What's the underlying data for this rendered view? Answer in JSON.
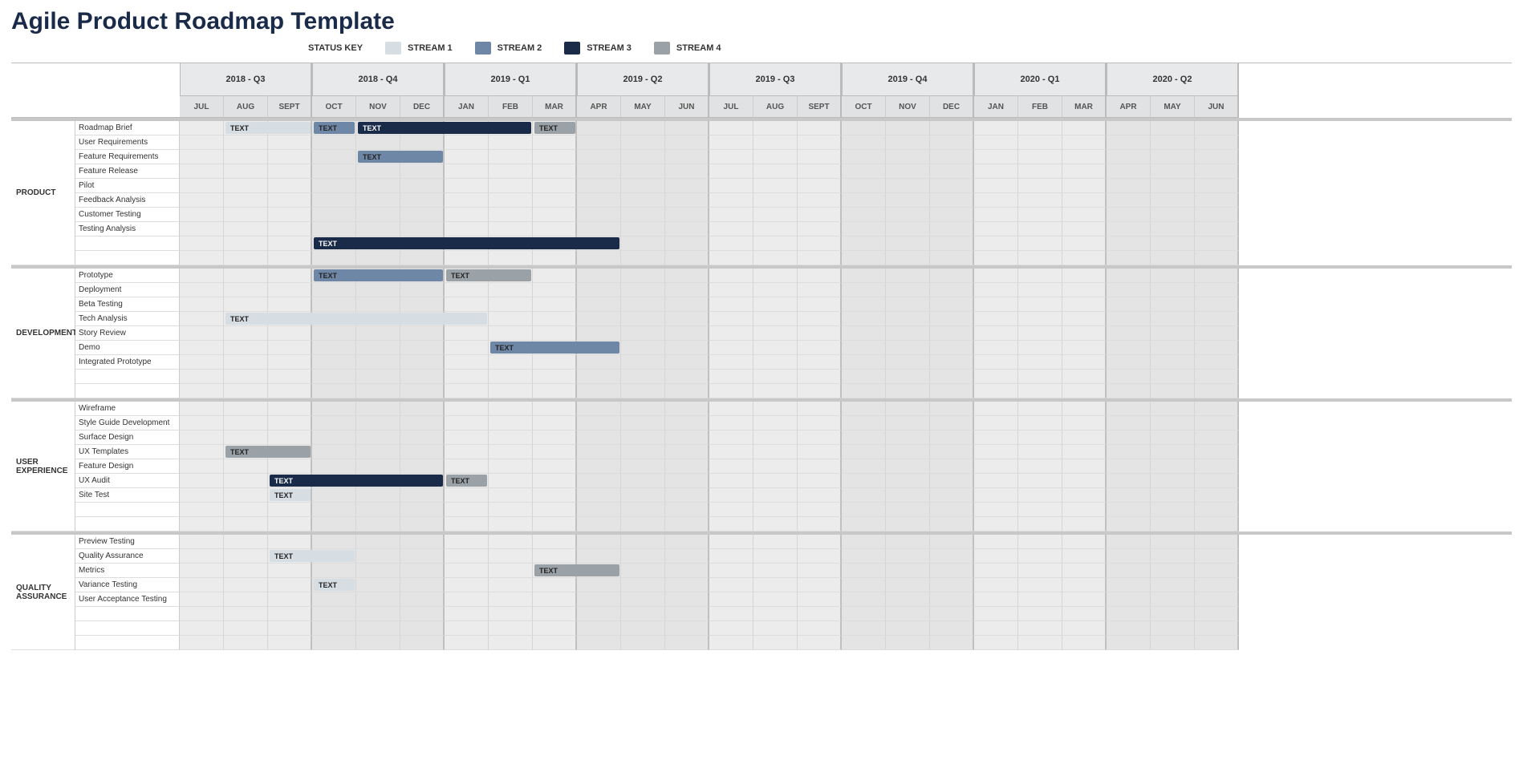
{
  "title": "Agile Product Roadmap Template",
  "legend": {
    "label": "STATUS KEY",
    "streams": [
      {
        "name": "STREAM 1",
        "class": "s1",
        "color": "#d6dde3"
      },
      {
        "name": "STREAM 2",
        "class": "s2",
        "color": "#6f87a6"
      },
      {
        "name": "STREAM 3",
        "class": "s3",
        "color": "#1a2b4a"
      },
      {
        "name": "STREAM 4",
        "class": "s4",
        "color": "#9aa2a8"
      }
    ]
  },
  "quarters": [
    "2018 - Q3",
    "2018 - Q4",
    "2019 - Q1",
    "2019 - Q2",
    "2019 - Q3",
    "2019 - Q4",
    "2020 - Q1",
    "2020 - Q2"
  ],
  "months": [
    "JUL",
    "AUG",
    "SEPT",
    "OCT",
    "NOV",
    "DEC",
    "JAN",
    "FEB",
    "MAR",
    "APR",
    "MAY",
    "JUN",
    "JUL",
    "AUG",
    "SEPT",
    "OCT",
    "NOV",
    "DEC",
    "JAN",
    "FEB",
    "MAR",
    "APR",
    "MAY",
    "JUN"
  ],
  "sections": [
    {
      "name": "PRODUCT",
      "rows": [
        {
          "label": "Roadmap Brief",
          "bars": [
            {
              "stream": "s1",
              "start": 1,
              "span": 2,
              "text": "TEXT"
            },
            {
              "stream": "s2",
              "start": 3,
              "span": 1,
              "text": "TEXT"
            },
            {
              "stream": "s3",
              "start": 4,
              "span": 4,
              "text": "TEXT"
            },
            {
              "stream": "s4",
              "start": 8,
              "span": 1,
              "text": "TEXT"
            }
          ]
        },
        {
          "label": "User Requirements",
          "bars": []
        },
        {
          "label": "Feature Requirements",
          "bars": [
            {
              "stream": "s2",
              "start": 4,
              "span": 2,
              "text": "TEXT"
            }
          ]
        },
        {
          "label": "Feature Release",
          "bars": []
        },
        {
          "label": "Pilot",
          "bars": []
        },
        {
          "label": "Feedback Analysis",
          "bars": []
        },
        {
          "label": "Customer Testing",
          "bars": []
        },
        {
          "label": "Testing Analysis",
          "bars": []
        },
        {
          "label": "",
          "bars": [
            {
              "stream": "s3",
              "start": 3,
              "span": 7,
              "text": "TEXT"
            }
          ]
        },
        {
          "label": "",
          "bars": []
        }
      ]
    },
    {
      "name": "DEVELOPMENT",
      "rows": [
        {
          "label": "Prototype",
          "bars": [
            {
              "stream": "s2",
              "start": 3,
              "span": 3,
              "text": "TEXT"
            },
            {
              "stream": "s4",
              "start": 6,
              "span": 2,
              "text": "TEXT"
            }
          ]
        },
        {
          "label": "Deployment",
          "bars": []
        },
        {
          "label": "Beta Testing",
          "bars": []
        },
        {
          "label": "Tech Analysis",
          "bars": [
            {
              "stream": "s1",
              "start": 1,
              "span": 6,
              "text": "TEXT"
            }
          ]
        },
        {
          "label": "Story Review",
          "bars": []
        },
        {
          "label": "Demo",
          "bars": [
            {
              "stream": "s2",
              "start": 7,
              "span": 3,
              "text": "TEXT"
            }
          ]
        },
        {
          "label": "Integrated Prototype",
          "bars": []
        },
        {
          "label": "",
          "bars": []
        },
        {
          "label": "",
          "bars": []
        }
      ]
    },
    {
      "name": "USER EXPERIENCE",
      "rows": [
        {
          "label": "Wireframe",
          "bars": []
        },
        {
          "label": "Style Guide Development",
          "bars": []
        },
        {
          "label": "Surface Design",
          "bars": []
        },
        {
          "label": "UX Templates",
          "bars": [
            {
              "stream": "s4",
              "start": 1,
              "span": 2,
              "text": "TEXT"
            }
          ]
        },
        {
          "label": "Feature Design",
          "bars": []
        },
        {
          "label": "UX Audit",
          "bars": [
            {
              "stream": "s3",
              "start": 2,
              "span": 4,
              "text": "TEXT"
            },
            {
              "stream": "s4",
              "start": 6,
              "span": 1,
              "text": "TEXT"
            }
          ]
        },
        {
          "label": "Site Test",
          "bars": [
            {
              "stream": "s1",
              "start": 2,
              "span": 1,
              "text": "TEXT"
            }
          ]
        },
        {
          "label": "",
          "bars": []
        },
        {
          "label": "",
          "bars": []
        }
      ]
    },
    {
      "name": "QUALITY ASSURANCE",
      "rows": [
        {
          "label": "Preview Testing",
          "bars": []
        },
        {
          "label": "Quality Assurance",
          "bars": [
            {
              "stream": "s1",
              "start": 2,
              "span": 2,
              "text": "TEXT"
            }
          ]
        },
        {
          "label": "Metrics",
          "bars": [
            {
              "stream": "s4",
              "start": 8,
              "span": 2,
              "text": "TEXT"
            }
          ]
        },
        {
          "label": "Variance Testing",
          "bars": [
            {
              "stream": "s1",
              "start": 3,
              "span": 1,
              "text": "TEXT"
            }
          ]
        },
        {
          "label": "User Acceptance Testing",
          "bars": []
        },
        {
          "label": "",
          "bars": []
        },
        {
          "label": "",
          "bars": []
        },
        {
          "label": "",
          "bars": []
        }
      ]
    }
  ],
  "chart_data": {
    "type": "table",
    "note": "Agile roadmap gantt. Month index 0=JUL 2018 .. 23=JUN 2020. start is month index, span is month count.",
    "months": [
      "JUL 2018",
      "AUG 2018",
      "SEPT 2018",
      "OCT 2018",
      "NOV 2018",
      "DEC 2018",
      "JAN 2019",
      "FEB 2019",
      "MAR 2019",
      "APR 2019",
      "MAY 2019",
      "JUN 2019",
      "JUL 2019",
      "AUG 2019",
      "SEPT 2019",
      "OCT 2019",
      "NOV 2019",
      "DEC 2019",
      "JAN 2020",
      "FEB 2020",
      "MAR 2020",
      "APR 2020",
      "MAY 2020",
      "JUN 2020"
    ],
    "streams": {
      "s1": "STREAM 1",
      "s2": "STREAM 2",
      "s3": "STREAM 3",
      "s4": "STREAM 4"
    }
  }
}
